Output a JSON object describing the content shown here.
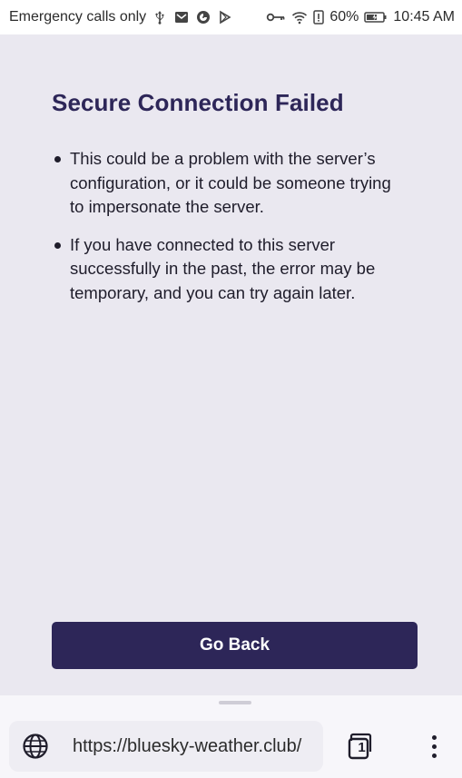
{
  "status_bar": {
    "carrier_text": "Emergency calls only",
    "battery": "60%",
    "time": "10:45 AM",
    "left_icons": [
      "usb-icon",
      "mail-icon",
      "firefox-icon",
      "play-store-icon"
    ],
    "right_icons": [
      "vpn-key-icon",
      "wifi-icon",
      "alert-icon",
      "battery-icon"
    ]
  },
  "page": {
    "title": "Secure Connection Failed",
    "bullets": [
      "This could be a problem with the server’s configuration, or it could be someone trying to impersonate the server.",
      "If you have connected to this server successfully in the past, the error may be temporary, and you can try again later."
    ],
    "go_back_label": "Go Back"
  },
  "toolbar": {
    "url": "https://bluesky-weather.club/",
    "tab_count": "1"
  },
  "colors": {
    "accent": "#2d2658",
    "background": "#eae8f0",
    "toolbar_bg": "#f7f6fa"
  }
}
